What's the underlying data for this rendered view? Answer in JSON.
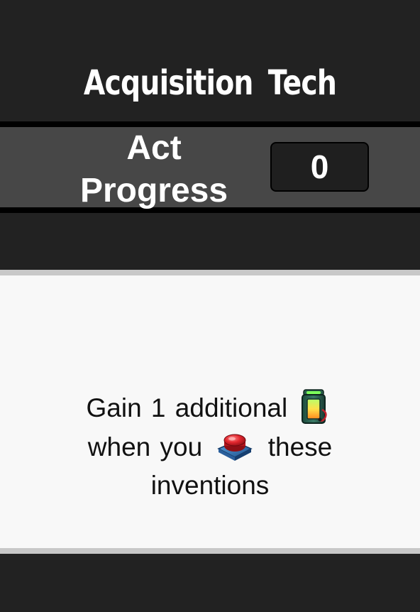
{
  "card": {
    "title": "Acquisition Tech",
    "progress": {
      "label": "Act Progress",
      "value": "0"
    },
    "effect": {
      "line1": "Gain 1 additional",
      "line1_icon": "battery-energy-icon",
      "line2_before": "when you",
      "line2_icon": "red-push-button-icon",
      "line2_after": "these",
      "line3": "inventions"
    },
    "colors": {
      "background": "#222222",
      "band": "#474747",
      "panel": "#f8f8f8",
      "panel_border": "#c8c8c8"
    }
  }
}
